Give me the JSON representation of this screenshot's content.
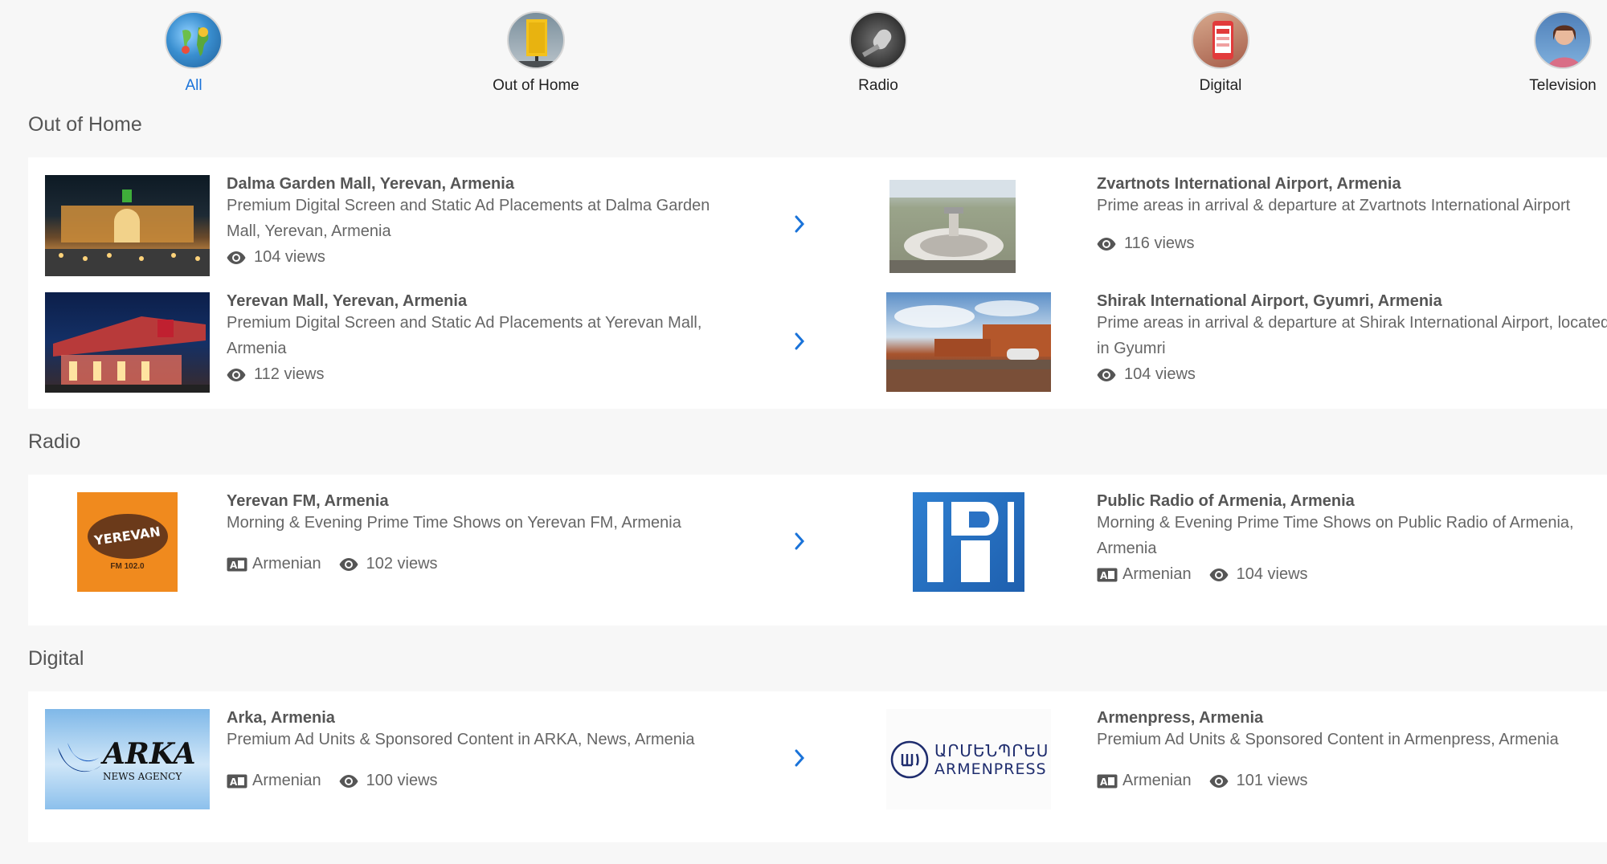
{
  "categories": [
    {
      "label": "All",
      "icon": "globe-icon",
      "active": true
    },
    {
      "label": "Out of Home",
      "icon": "billboard-icon"
    },
    {
      "label": "Radio",
      "icon": "microphone-icon"
    },
    {
      "label": "Digital",
      "icon": "phone-icon"
    },
    {
      "label": "Television",
      "icon": "tv-presenter-icon"
    }
  ],
  "sections": {
    "ooh": {
      "title": "Out of Home",
      "items": [
        {
          "title": "Dalma Garden Mall, Yerevan, Armenia",
          "description": "Premium Digital Screen and Static Ad Placements at Dalma Garden Mall, Yerevan, Armenia",
          "views": "104 views"
        },
        {
          "title": "Zvartnots International Airport, Armenia",
          "description": "Prime areas in arrival & departure at Zvartnots International Airport",
          "views": "116 views"
        },
        {
          "title": "Yerevan Mall, Yerevan, Armenia",
          "description": "Premium Digital Screen and Static Ad Placements at Yerevan Mall, Armenia",
          "views": "112 views"
        },
        {
          "title": "Shirak International Airport, Gyumri, Armenia",
          "description": "Prime areas in arrival & departure at Shirak International Airport, located in Gyumri",
          "views": "104 views"
        }
      ]
    },
    "radio": {
      "title": "Radio",
      "items": [
        {
          "title": "Yerevan FM, Armenia",
          "description": "Morning & Evening Prime Time Shows on Yerevan FM, Armenia",
          "language": "Armenian",
          "views": "102 views",
          "logo_text": "YEREVAN",
          "logo_sub": "FM 102.0"
        },
        {
          "title": "Public Radio of Armenia, Armenia",
          "description": "Morning & Evening Prime Time Shows on Public Radio of Armenia, Armenia",
          "language": "Armenian",
          "views": "104 views"
        }
      ]
    },
    "digital": {
      "title": "Digital",
      "items": [
        {
          "title": "Arka, Armenia",
          "description": "Premium Ad Units & Sponsored Content in ARKA, News, Armenia",
          "language": "Armenian",
          "views": "100 views",
          "logo_text": "ARKA",
          "logo_sub": "NEWS AGENCY"
        },
        {
          "title": "Armenpress, Armenia",
          "description": "Premium Ad Units & Sponsored Content in Armenpress, Armenia",
          "language": "Armenian",
          "views": "101 views",
          "logo_text": "ԱՐՄԵՆՊՐԵՍ",
          "logo_sub": "ARMENPRESS"
        }
      ]
    }
  },
  "colors": {
    "accent": "#1a73d9",
    "text": "#555555",
    "panel": "#ffffff",
    "bg": "#f7f7f7"
  }
}
